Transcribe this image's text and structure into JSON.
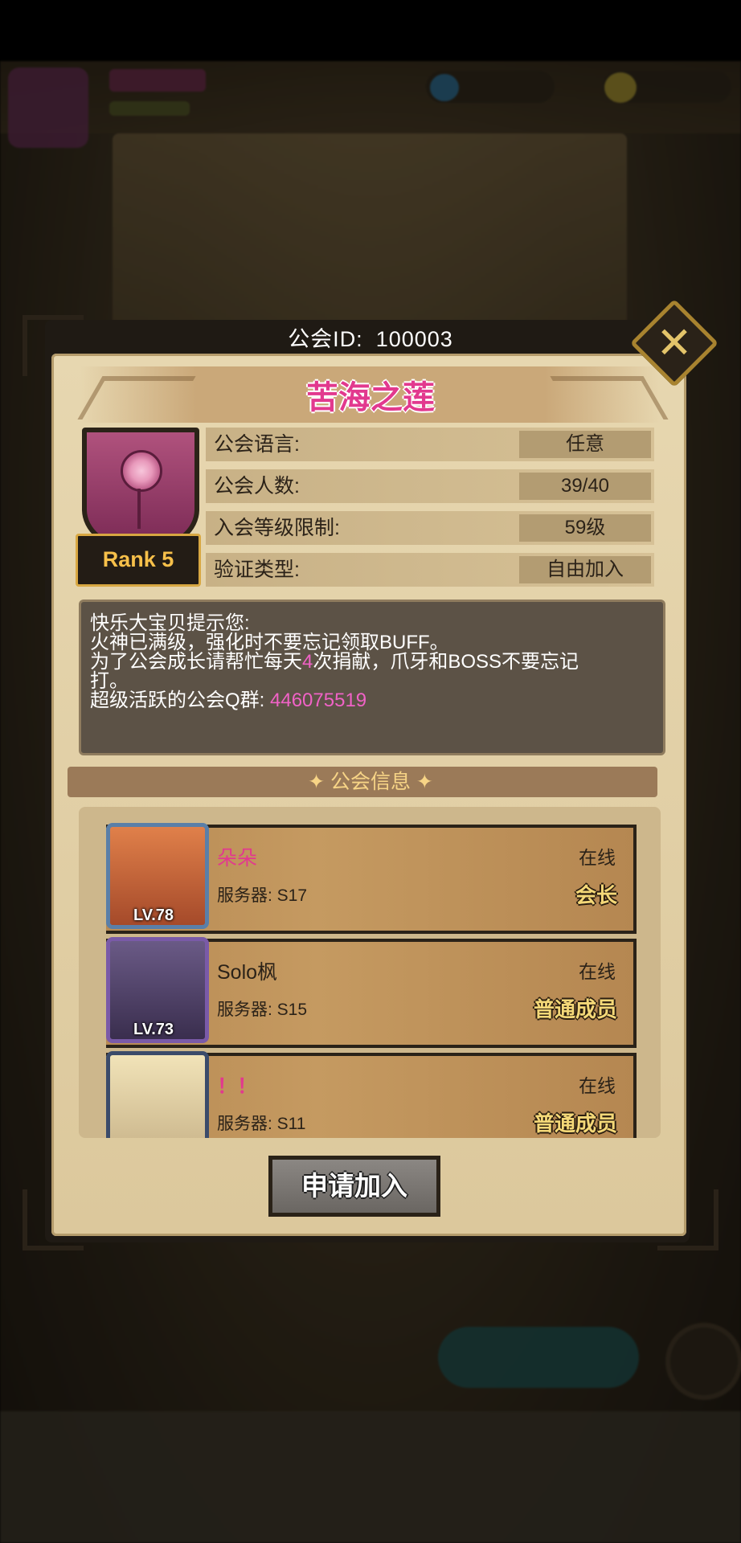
{
  "dialog": {
    "guild_id_label": "公会ID:",
    "guild_id_value": "100003",
    "guild_name": "苦海之莲",
    "rank": "Rank 5",
    "close_icon": "close-x-icon",
    "info": [
      {
        "label": "公会语言:",
        "value": "任意"
      },
      {
        "label": "公会人数:",
        "value": "39/40"
      },
      {
        "label": "入会等级限制:",
        "value": "59级"
      },
      {
        "label": "验证类型:",
        "value": "自由加入"
      }
    ],
    "notice": {
      "line1": "快乐大宝贝提示您:",
      "line2": "火神已满级，强化时不要忘记领取BUFF。",
      "line3_a": "为了公会成长请帮忙每天",
      "line3_num": "4",
      "line3_b": "次捐献，爪牙和BOSS不要忘记",
      "line3_c": "打。",
      "line4_a": "超级活跃的公会Q群: ",
      "line4_qq": "446075519"
    },
    "section_title": "✦ 公会信息 ✦",
    "members": [
      {
        "name": "朵朵",
        "name_color": "#e2398e",
        "level": "LV.78",
        "server": "服务器: S17",
        "status": "在线",
        "role": "会长"
      },
      {
        "name": "Solo枫",
        "name_color": "#2b2218",
        "level": "LV.73",
        "server": "服务器: S15",
        "status": "在线",
        "role": "普通成员"
      },
      {
        "name": "！！",
        "name_color": "#e2398e",
        "level": "",
        "server": "服务器: S11",
        "status": "在线",
        "role": "普通成员"
      }
    ],
    "apply_button": "申请加入"
  },
  "colors": {
    "accent_pink": "#e2398e",
    "panel": "#e7d7b0",
    "gold": "#f4d878"
  }
}
